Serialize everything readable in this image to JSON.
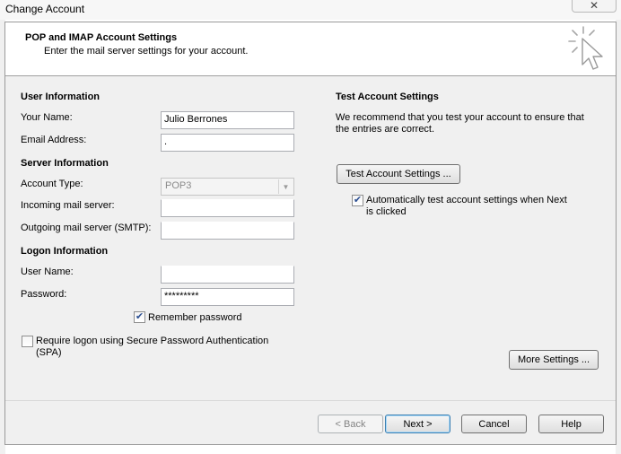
{
  "window": {
    "title": "Change Account",
    "close_glyph": "✕"
  },
  "header": {
    "title": "POP and IMAP Account Settings",
    "subtitle": "Enter the mail server settings for your account.",
    "icon": "cursor-click-icon"
  },
  "user_info": {
    "heading": "User Information",
    "name_label": "Your Name:",
    "name_value": "Julio Berrones",
    "email_label": "Email Address:",
    "email_value": "."
  },
  "server_info": {
    "heading": "Server Information",
    "account_type_label": "Account Type:",
    "account_type_value": "POP3",
    "incoming_label": "Incoming mail server:",
    "incoming_value": "",
    "outgoing_label": "Outgoing mail server (SMTP):",
    "outgoing_value": ""
  },
  "logon_info": {
    "heading": "Logon Information",
    "username_label": "User Name:",
    "username_value": "",
    "password_label": "Password:",
    "password_value": "*********",
    "remember_label": "Remember password",
    "remember_checked": true,
    "spa_label_line1": "Require logon using Secure Password Authentication",
    "spa_label_line2": "(SPA)",
    "spa_checked": false
  },
  "test_settings": {
    "heading": "Test Account Settings",
    "description_line1": "We recommend that you test your account to ensure that",
    "description_line2": "the entries are correct.",
    "test_button": "Test Account Settings ...",
    "auto_test_line1": "Automatically test account settings when Next",
    "auto_test_line2": "is clicked",
    "auto_test_checked": true
  },
  "more_settings_button": "More Settings ...",
  "footer": {
    "back": "< Back",
    "next": "Next >",
    "cancel": "Cancel",
    "help": "Help"
  },
  "check_glyph": "✔",
  "dropdown_glyph": "▼"
}
